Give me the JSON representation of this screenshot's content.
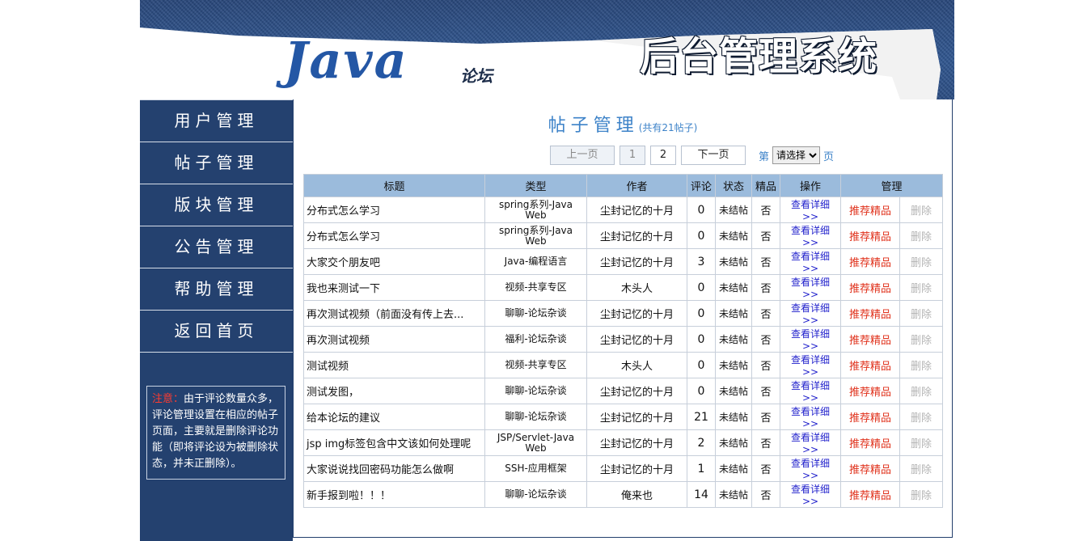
{
  "header": {
    "logo_text": "Java",
    "logo_sub": "论坛",
    "system_title": "后台管理系统"
  },
  "sidebar": {
    "items": [
      {
        "label": "用户管理",
        "name": "sidebar-item-users"
      },
      {
        "label": "帖子管理",
        "name": "sidebar-item-posts"
      },
      {
        "label": "版块管理",
        "name": "sidebar-item-boards"
      },
      {
        "label": "公告管理",
        "name": "sidebar-item-notices"
      },
      {
        "label": "帮助管理",
        "name": "sidebar-item-help"
      },
      {
        "label": "返回首页",
        "name": "sidebar-item-home"
      }
    ],
    "notice": {
      "prefix": "注意：",
      "text": "由于评论数量众多，评论管理设置在相应的帖子页面，主要就是删除评论功能（即将评论设为被删除状态，并未正删除）。"
    }
  },
  "main": {
    "heading": "帖子管理",
    "count_text": "(共有21帖子)",
    "pager": {
      "prev": "上一页",
      "pages": [
        "1",
        "2"
      ],
      "next": "下一页",
      "page_prefix": "第",
      "select_value": "请选择",
      "page_suffix": "页"
    },
    "columns": [
      "标题",
      "类型",
      "作者",
      "评论",
      "状态",
      "精品",
      "操作",
      "管理"
    ],
    "rows": [
      {
        "title": "分布式怎么学习",
        "type": "spring系列-Java Web",
        "author": "尘封记忆的十月",
        "comments": "0",
        "state": "未结帖",
        "fine": "否",
        "op": "查看详细>>",
        "rec": "推荐精品",
        "del": "删除"
      },
      {
        "title": "分布式怎么学习",
        "type": "spring系列-Java Web",
        "author": "尘封记忆的十月",
        "comments": "0",
        "state": "未结帖",
        "fine": "否",
        "op": "查看详细>>",
        "rec": "推荐精品",
        "del": "删除"
      },
      {
        "title": "大家交个朋友吧",
        "type": "Java-编程语言",
        "author": "尘封记忆的十月",
        "comments": "3",
        "state": "未结帖",
        "fine": "否",
        "op": "查看详细>>",
        "rec": "推荐精品",
        "del": "删除"
      },
      {
        "title": "我也来测试一下",
        "type": "视频-共享专区",
        "author": "木头人",
        "comments": "0",
        "state": "未结帖",
        "fine": "否",
        "op": "查看详细>>",
        "rec": "推荐精品",
        "del": "删除"
      },
      {
        "title": "再次测试视频（前面没有传上去...",
        "type": "聊聊-论坛杂谈",
        "author": "尘封记忆的十月",
        "comments": "0",
        "state": "未结帖",
        "fine": "否",
        "op": "查看详细>>",
        "rec": "推荐精品",
        "del": "删除"
      },
      {
        "title": "再次测试视频",
        "type": "福利-论坛杂谈",
        "author": "尘封记忆的十月",
        "comments": "0",
        "state": "未结帖",
        "fine": "否",
        "op": "查看详细>>",
        "rec": "推荐精品",
        "del": "删除"
      },
      {
        "title": "测试视频",
        "type": "视频-共享专区",
        "author": "木头人",
        "comments": "0",
        "state": "未结帖",
        "fine": "否",
        "op": "查看详细>>",
        "rec": "推荐精品",
        "del": "删除"
      },
      {
        "title": "测试发图，",
        "type": "聊聊-论坛杂谈",
        "author": "尘封记忆的十月",
        "comments": "0",
        "state": "未结帖",
        "fine": "否",
        "op": "查看详细>>",
        "rec": "推荐精品",
        "del": "删除"
      },
      {
        "title": "给本论坛的建议",
        "type": "聊聊-论坛杂谈",
        "author": "尘封记忆的十月",
        "comments": "21",
        "state": "未结帖",
        "fine": "否",
        "op": "查看详细>>",
        "rec": "推荐精品",
        "del": "删除"
      },
      {
        "title": "jsp img标签包含中文该如何处理呢",
        "type": "JSP/Servlet-Java Web",
        "author": "尘封记忆的十月",
        "comments": "2",
        "state": "未结帖",
        "fine": "否",
        "op": "查看详细>>",
        "rec": "推荐精品",
        "del": "删除"
      },
      {
        "title": "大家说说找回密码功能怎么做啊",
        "type": "SSH-应用框架",
        "author": "尘封记忆的十月",
        "comments": "1",
        "state": "未结帖",
        "fine": "否",
        "op": "查看详细>>",
        "rec": "推荐精品",
        "del": "删除"
      },
      {
        "title": "新手报到啦！！！",
        "type": "聊聊-论坛杂谈",
        "author": "俺来也",
        "comments": "14",
        "state": "未结帖",
        "fine": "否",
        "op": "查看详细>>",
        "rec": "推荐精品",
        "del": "删除"
      }
    ]
  }
}
